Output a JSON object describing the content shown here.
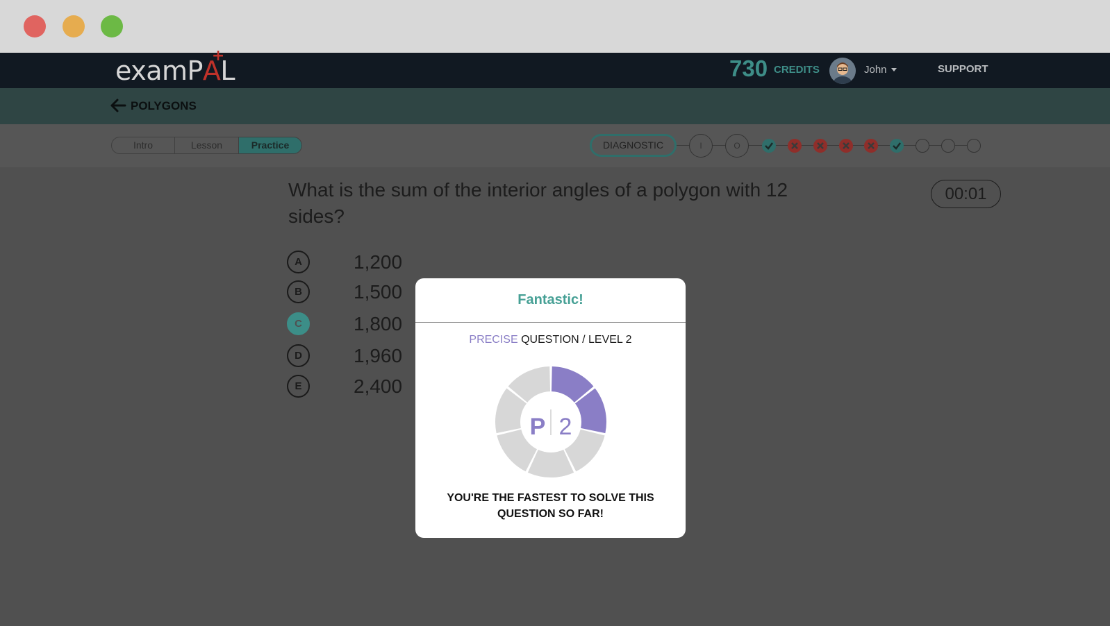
{
  "app": {
    "logo_main": "examP",
    "logo_a": "A",
    "logo_end": "L",
    "logo_plus": "+"
  },
  "header": {
    "credits_value": "730",
    "credits_label": "CREDITS",
    "user_name": "John",
    "support_label": "SUPPORT"
  },
  "breadcrumb": {
    "title": "POLYGONS"
  },
  "tabs": [
    {
      "label": "Intro",
      "active": false
    },
    {
      "label": "Lesson",
      "active": false
    },
    {
      "label": "Practice",
      "active": true
    }
  ],
  "progress": {
    "diagnostic_label": "DIAGNOSTIC",
    "steps": [
      {
        "state": "intro",
        "label": "I"
      },
      {
        "state": "current",
        "label": "O"
      },
      {
        "state": "correct",
        "label": ""
      },
      {
        "state": "wrong",
        "label": ""
      },
      {
        "state": "wrong",
        "label": ""
      },
      {
        "state": "wrong",
        "label": ""
      },
      {
        "state": "wrong",
        "label": ""
      },
      {
        "state": "correct",
        "label": ""
      },
      {
        "state": "pending",
        "label": ""
      },
      {
        "state": "pending",
        "label": ""
      },
      {
        "state": "pending",
        "label": ""
      }
    ]
  },
  "question": {
    "text": "What is the sum of the interior angles of a polygon with 12 sides?",
    "timer": "00:01",
    "options": [
      {
        "letter": "A",
        "value": "1,200",
        "selected": false
      },
      {
        "letter": "B",
        "value": "1,500",
        "selected": false
      },
      {
        "letter": "C",
        "value": "1,800",
        "selected": true
      },
      {
        "letter": "D",
        "value": "1,960",
        "selected": false
      },
      {
        "letter": "E",
        "value": "2,400",
        "selected": false
      }
    ]
  },
  "modal": {
    "title": "Fantastic!",
    "subtitle_keyword": "PRECISE",
    "subtitle_rest": "QUESTION / LEVEL 2",
    "badge_letter": "P",
    "badge_level": "2",
    "level_filled": 2,
    "level_total": 7,
    "message": "YOU'RE THE FASTEST TO SOLVE THIS QUESTION SO FAR!"
  },
  "colors": {
    "accent_teal": "#3c8e88",
    "accent_purple": "#8a7ec6",
    "wrong_red": "#b03a34",
    "nav_dark": "#111922"
  }
}
